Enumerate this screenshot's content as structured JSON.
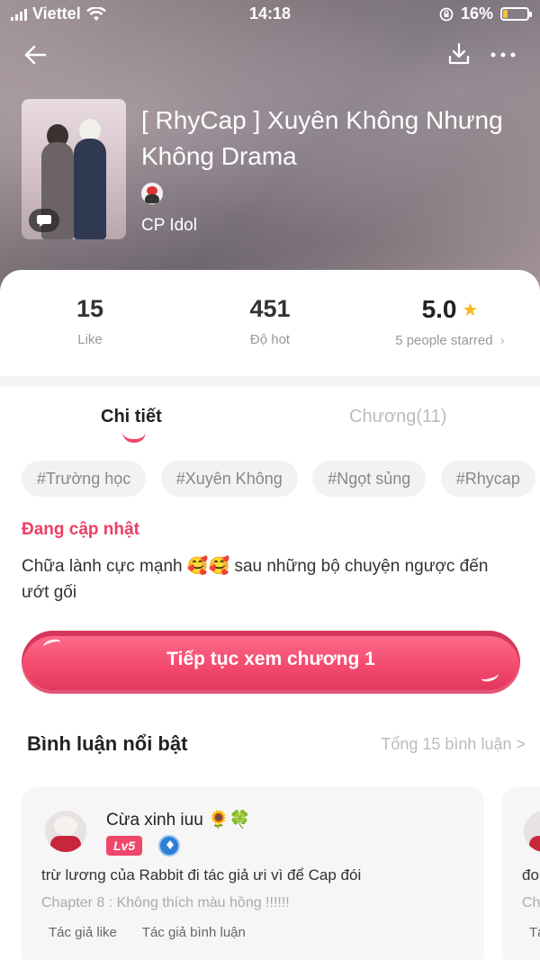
{
  "status_bar": {
    "carrier": "Viettel",
    "time": "14:18",
    "battery": "16%"
  },
  "book": {
    "title": "[ RhyCap ] Xuyên Không Nhưng Không Drama",
    "author": "CP Idol"
  },
  "stats": {
    "likes": "15",
    "likes_label": "Like",
    "hot": "451",
    "hot_label": "Độ hot",
    "rating": "5.0",
    "rating_label": "5 people starred",
    "rating_arrow": "›"
  },
  "tabs": [
    {
      "label": "Chi tiết",
      "active": true
    },
    {
      "label": "Chương(11)",
      "active": false
    }
  ],
  "tags": [
    "#Trường học",
    "#Xuyên Không",
    "#Ngọt sủng",
    "#Rhycap"
  ],
  "update_status": "Đang cập nhật",
  "description": "Chữa lành cực mạnh 🥰🥰 sau những bộ chuyện ngược đến ướt gối",
  "cta_label": "Tiếp tục xem chương 1",
  "comments_section": {
    "title": "Bình luận nổi bật",
    "total_link": "Tổng 15 bình luận >"
  },
  "comments": [
    {
      "name": "Cừa xinh iuu 🌻🍀",
      "level": "Lv5",
      "text": "trừ lương của Rabbit đi tác giả ưi vì để Cap đói",
      "chapter": "Chapter 8 : Không thích màu hồng !!!!!!",
      "meta": [
        "Tác giả like",
        "Tác giả bình luận"
      ]
    },
    {
      "text": "đo",
      "chapter": "Ch",
      "meta": [
        "Tá"
      ]
    }
  ],
  "icons": {
    "back": "arrow-left-icon",
    "download": "download-icon",
    "more": "more-dots-icon",
    "star": "star-icon"
  },
  "colors": {
    "accent": "#f0466a",
    "star": "#f5b91c"
  }
}
